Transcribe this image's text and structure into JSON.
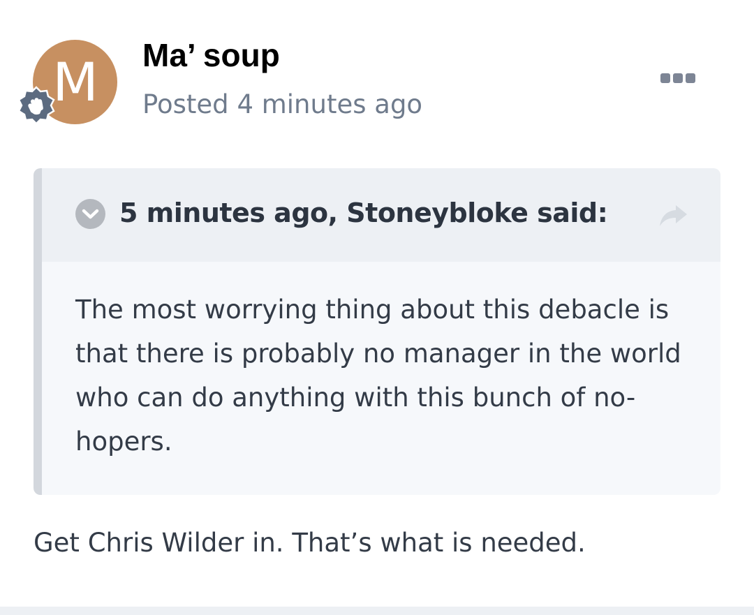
{
  "post": {
    "author": {
      "initial": "M",
      "name": "Ma’ soup",
      "avatar_color": "#c79061",
      "badge_icon": "waving-hand-icon"
    },
    "meta": {
      "posted_label": "Posted",
      "time": "4 minutes ago"
    },
    "menu_icon": "more-options-icon",
    "quote": {
      "citation": "5 minutes ago, Stoneybloke said:",
      "toggle_icon": "chevron-down-icon",
      "share_icon": "share-arrow-icon",
      "text": "The most worrying thing about this debacle is that there is probably no manager in the world who can do anything with this bunch of no-hopers."
    },
    "body": "Get Chris Wilder in. That’s what is needed."
  },
  "colors": {
    "meta_text": "#6f7b8c",
    "quote_header_bg": "#edf0f4",
    "quote_body_bg": "#f6f8fb",
    "quote_bar": "#d3d7dd"
  }
}
